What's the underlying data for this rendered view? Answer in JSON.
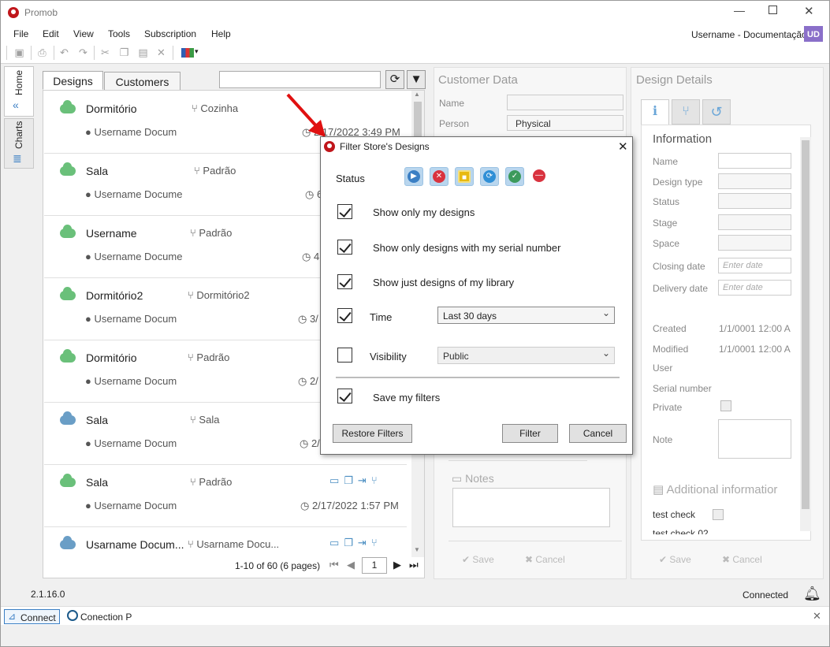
{
  "app": {
    "title": "Promob",
    "user_label": "Username - Documentação",
    "user_initials": "UD",
    "version": "2.1.16.0"
  },
  "menu": [
    "File",
    "Edit",
    "View",
    "Tools",
    "Subscription",
    "Help"
  ],
  "sidetabs": {
    "home": "Home",
    "charts": "Charts"
  },
  "designs_panel": {
    "tabs": [
      "Designs",
      "Customers"
    ],
    "search_value": "",
    "pagination": {
      "text": "1-10 of 60 (6 pages)",
      "page": "1"
    },
    "rows": [
      {
        "name": "Dormitório",
        "type": "Cozinha",
        "user": "Username Docum",
        "date": "2/17/2022 3:49 PM",
        "cloud": "green"
      },
      {
        "name": "Sala",
        "type": "Padrão",
        "user": "Username Docume",
        "date": "6",
        "cloud": "green"
      },
      {
        "name": "Username",
        "type": "Padrão",
        "user": "Username Docume",
        "date": "4",
        "cloud": "green"
      },
      {
        "name": "Dormitório2",
        "type": "Dormitório2",
        "user": "Username Docum",
        "date": "3/",
        "cloud": "green"
      },
      {
        "name": "Dormitório",
        "type": "Padrão",
        "user": "Username Docum",
        "date": "2/",
        "cloud": "green"
      },
      {
        "name": "Sala",
        "type": "Sala",
        "user": "Username Docum",
        "date": "2/",
        "cloud": "blue"
      },
      {
        "name": "Sala",
        "type": "Padrão",
        "user": "Username Docum",
        "date": "2/17/2022 1:57 PM",
        "cloud": "green"
      },
      {
        "name": "Usarname Docum...",
        "type": "Usarname Docu...",
        "user": "",
        "date": "",
        "cloud": "blue"
      }
    ]
  },
  "customer_panel": {
    "title": "Customer Data",
    "name_label": "Name",
    "name_value": "",
    "person_label": "Person",
    "person_value": "Physical",
    "notes_label": "Notes",
    "save": "Save",
    "cancel": "Cancel"
  },
  "design_details": {
    "title": "Design Details",
    "info_title": "Information",
    "fields": [
      "Name",
      "Design type",
      "Status",
      "Stage",
      "Space",
      "Closing date",
      "Delivery date"
    ],
    "date_placeholder": "Enter date",
    "created_label": "Created",
    "created_value": "1/1/0001 12:00 A",
    "modified_label": "Modified",
    "modified_value": "1/1/0001 12:00 A",
    "user_label": "User",
    "serial_label": "Serial number",
    "private_label": "Private",
    "note_label": "Note",
    "additional_title": "Additional informatior",
    "test_check": "test check",
    "test_check2": "test check 02",
    "save": "Save",
    "cancel": "Cancel"
  },
  "dialog": {
    "title": "Filter Store's Designs",
    "status_label": "Status",
    "options": [
      {
        "label": "Show only my designs",
        "checked": true
      },
      {
        "label": "Show only designs with my serial number",
        "checked": true
      },
      {
        "label": "Show just designs of my library",
        "checked": true
      }
    ],
    "time_label": "Time",
    "time_checked": true,
    "time_value": "Last 30 days",
    "visibility_label": "Visibility",
    "visibility_checked": false,
    "visibility_value": "Public",
    "save_filters_label": "Save my filters",
    "save_filters_checked": true,
    "restore_button": "Restore Filters",
    "filter_button": "Filter",
    "cancel_button": "Cancel",
    "status_colors": [
      "#3b7fc4",
      "#d9333f",
      "#e8b90f",
      "#2f8fd6",
      "#3c9a5c",
      "#d9333f"
    ]
  },
  "statusbar": {
    "connected": "Connected",
    "connect_tab": "Connect",
    "connection_tab": "Conection P"
  },
  "accent": "#c0161b",
  "arrow_color": "#e01010"
}
